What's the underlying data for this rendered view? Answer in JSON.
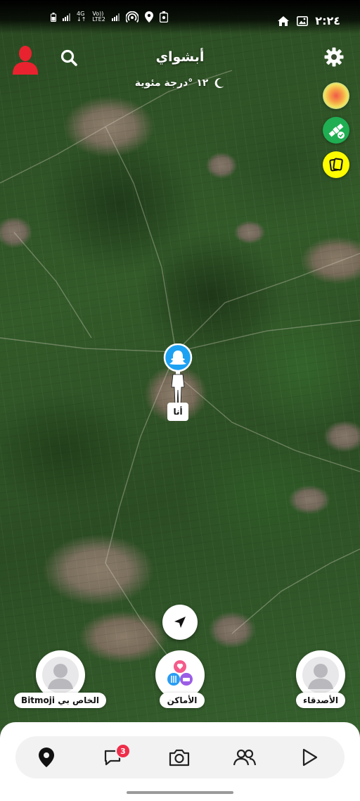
{
  "status_bar": {
    "time": "٢:٢٤",
    "network_4g": "4G",
    "network_volte": "Vo))",
    "network_lte": "LTE2"
  },
  "header": {
    "location_name": "أبشواي",
    "weather": "١٢ °درجة مئوية",
    "weather_icon": "moon-icon"
  },
  "me_marker": {
    "label": "أنا"
  },
  "shortcuts": {
    "my_bitmoji": "Bitmoji الخاص بي",
    "places": "الأماكن",
    "friends": "الأصدقاء"
  },
  "bottom_nav": {
    "items": [
      "map-icon",
      "chat-icon",
      "camera-icon",
      "friends-icon",
      "play-icon"
    ],
    "chat_badge": "3"
  },
  "colors": {
    "accent_red": "#e8232f",
    "snap_yellow": "#fffc00",
    "snap_blue": "#1da1f2",
    "badge_red": "#ef2e4a"
  }
}
